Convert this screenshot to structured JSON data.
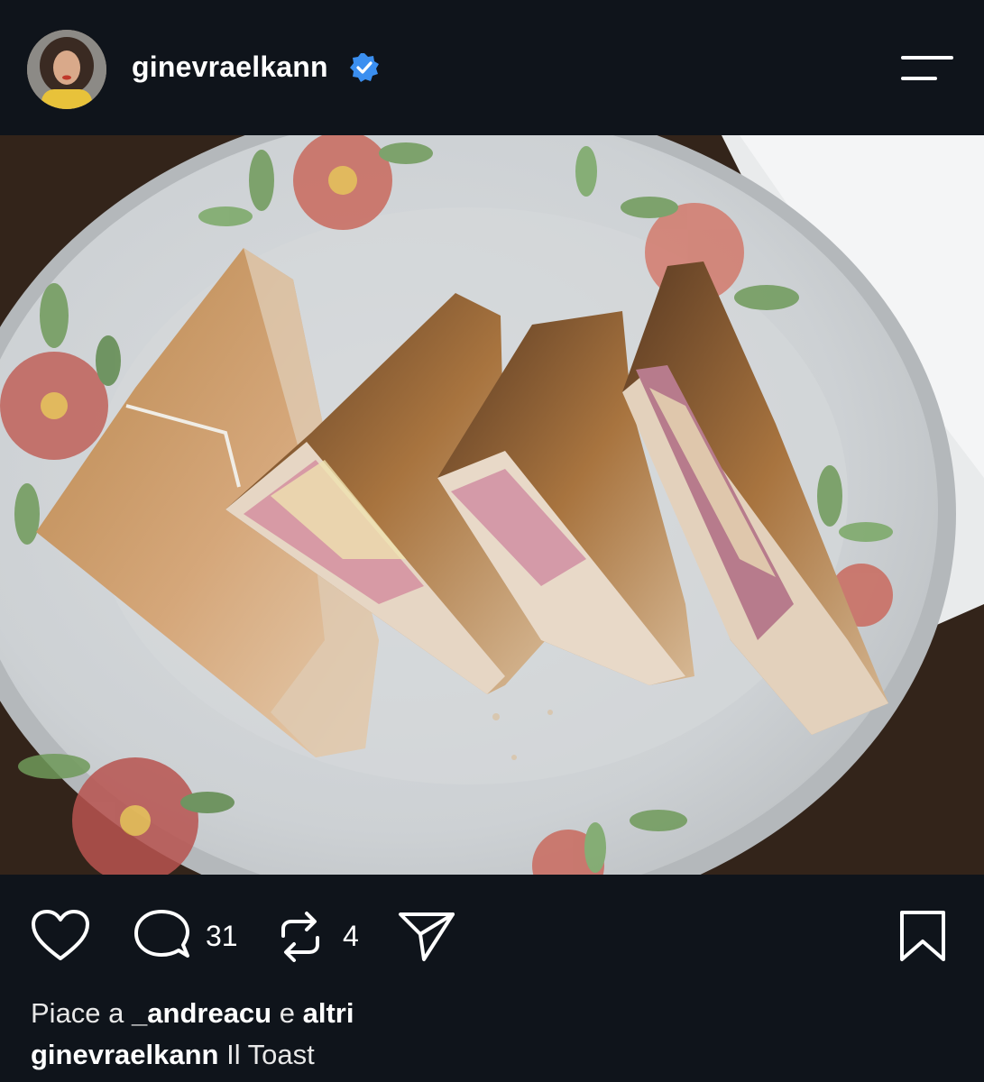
{
  "post": {
    "username": "ginevraelkann",
    "verified_icon": "verified-badge-icon",
    "menu_icon": "menu-icon"
  },
  "actions": {
    "like_icon": "heart-icon",
    "comment_icon": "comment-bubble-icon",
    "comment_count": "31",
    "repost_icon": "repost-icon",
    "repost_count": "4",
    "share_icon": "send-icon",
    "save_icon": "bookmark-icon"
  },
  "likes": {
    "prefix": "Piace a",
    "user": "_andreacu",
    "connector": "e",
    "others": "altri"
  },
  "caption": {
    "user": "ginevraelkann",
    "text": "Il Toast"
  },
  "colors": {
    "background": "#0f141b",
    "verified": "#3b8ff0",
    "text": "#ffffff"
  }
}
